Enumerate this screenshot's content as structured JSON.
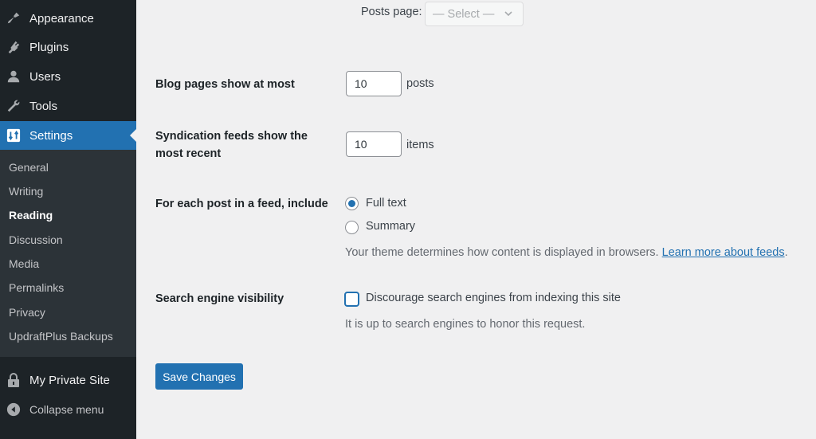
{
  "sidebar": {
    "menu": [
      {
        "label": "Appearance",
        "icon": "paintbrush-icon"
      },
      {
        "label": "Plugins",
        "icon": "plugin-icon"
      },
      {
        "label": "Users",
        "icon": "user-icon"
      },
      {
        "label": "Tools",
        "icon": "wrench-icon"
      },
      {
        "label": "Settings",
        "icon": "settings-icon",
        "current": true
      }
    ],
    "submenu": [
      {
        "label": "General"
      },
      {
        "label": "Writing"
      },
      {
        "label": "Reading",
        "current": true
      },
      {
        "label": "Discussion"
      },
      {
        "label": "Media"
      },
      {
        "label": "Permalinks"
      },
      {
        "label": "Privacy"
      },
      {
        "label": "UpdraftPlus Backups"
      }
    ],
    "private_site": {
      "label": "My Private Site",
      "icon": "lock-icon"
    },
    "collapse": {
      "label": "Collapse menu",
      "icon": "collapse-icon"
    }
  },
  "main": {
    "posts_page": {
      "label": "Posts page:",
      "selected": "— Select —"
    },
    "blog_pages": {
      "label": "Blog pages show at most",
      "value": "10",
      "suffix": "posts"
    },
    "syndication": {
      "label_line1": "Syndication feeds show the",
      "label_line2": "most recent",
      "value": "10",
      "suffix": "items"
    },
    "feed_include": {
      "label": "For each post in a feed, include",
      "options": [
        {
          "label": "Full text",
          "checked": true
        },
        {
          "label": "Summary",
          "checked": false
        }
      ],
      "description": "Your theme determines how content is displayed in browsers.",
      "link": "Learn more about feeds",
      "after_link": "."
    },
    "search_visibility": {
      "label": "Search engine visibility",
      "checkbox_label": "Discourage search engines from indexing this site",
      "checked": false,
      "description": "It is up to search engines to honor this request."
    },
    "save_label": "Save Changes"
  },
  "colors": {
    "accent": "#2271b1",
    "sidebar_bg": "#1d2327",
    "submenu_bg": "#2c3338",
    "page_bg": "#f0f0f1"
  }
}
